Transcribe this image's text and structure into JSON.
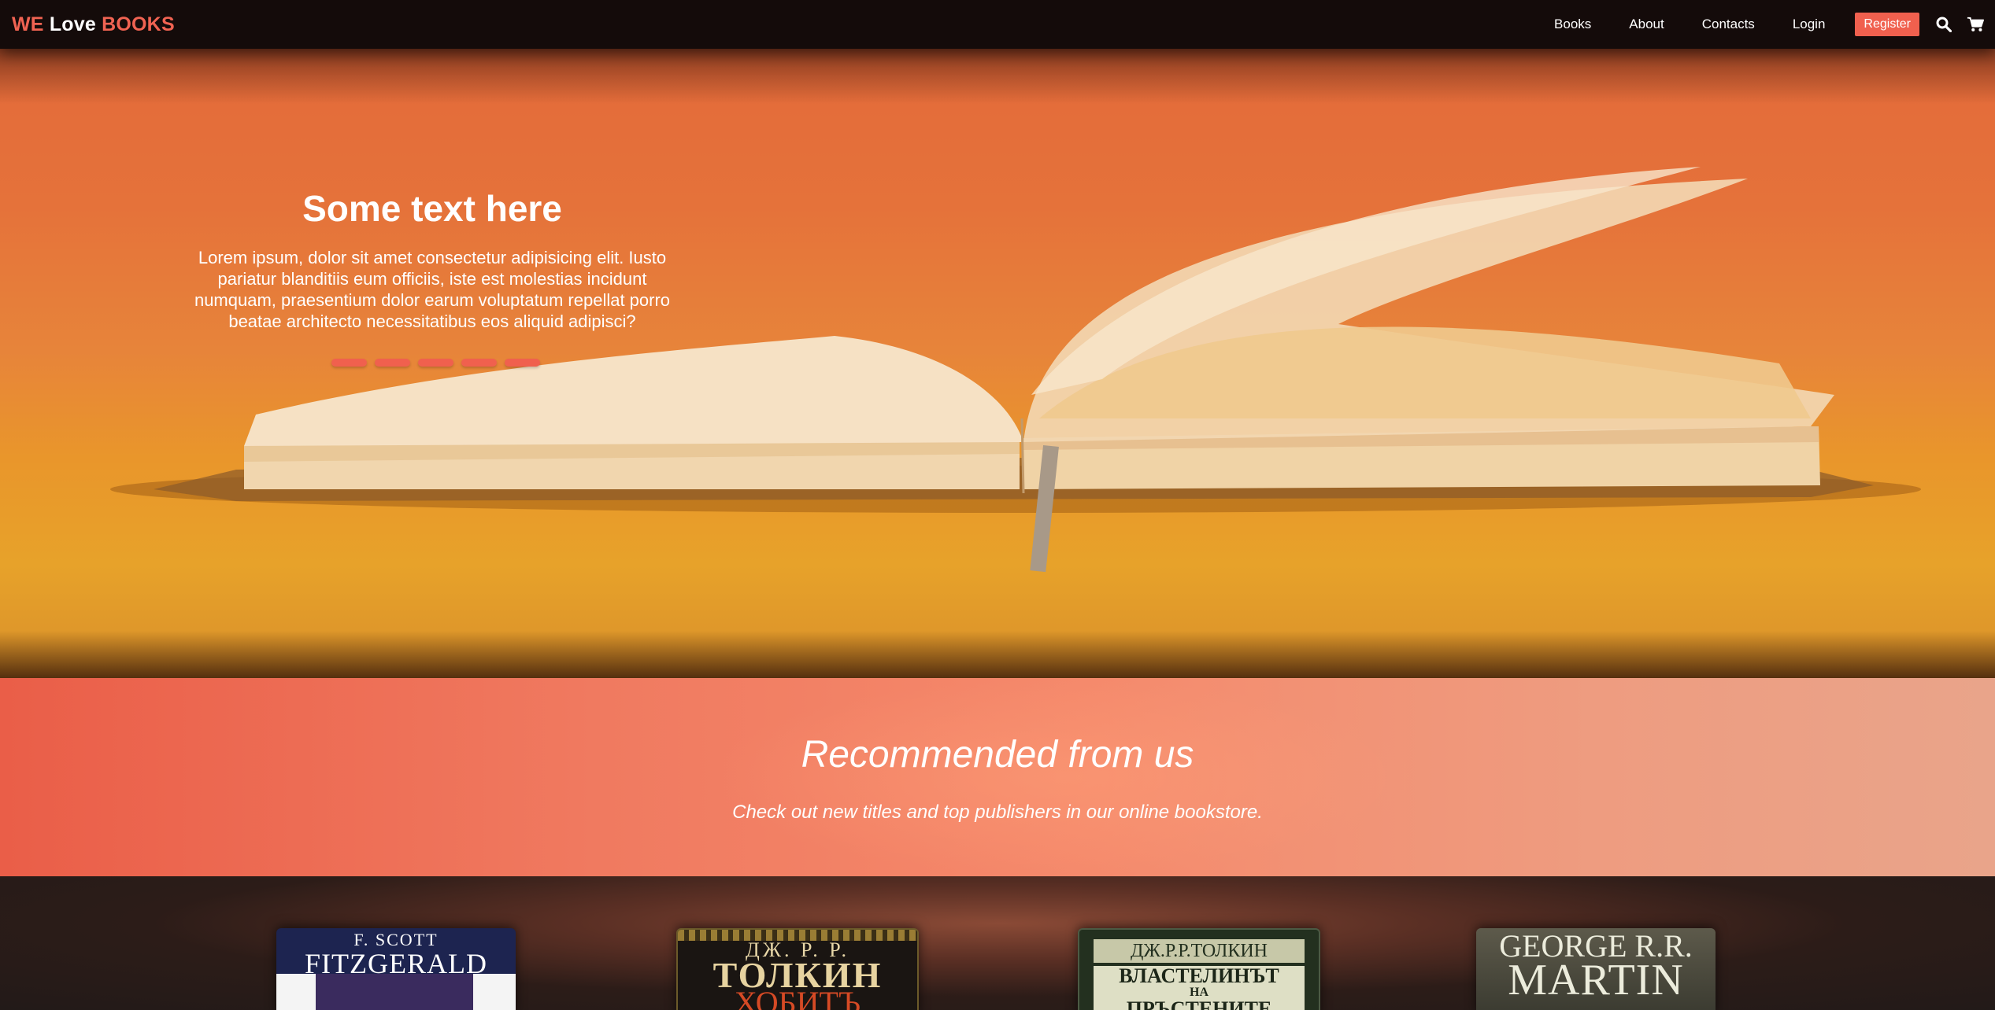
{
  "brand": {
    "part1": "WE",
    "part2": "Love",
    "part3": "BOOKS"
  },
  "nav": {
    "items": [
      "Books",
      "About",
      "Contacts",
      "Login"
    ],
    "register": "Register",
    "icons": {
      "search": "search-icon",
      "cart": "cart-icon"
    }
  },
  "hero": {
    "title": "Some text here",
    "text": "Lorem ipsum, dolor sit amet consectetur adipisicing elit. Iusto pariatur blanditiis eum officiis, iste est molestias incidunt numquam, praesentium dolor earum voluptatum repellat porro beatae architecto necessitatibus eos aliquid adipisci?",
    "indicator_count": 5
  },
  "recommended": {
    "title": "Recommended from us",
    "subtitle": "Check out new titles and top publishers in our online bookstore."
  },
  "books": [
    {
      "line1": "F. SCOTT",
      "line2": "FITZGERALD"
    },
    {
      "line1": "ДЖ. Р. Р.",
      "line2": "ТОЛКИН",
      "line3": "ХОБИТЪ"
    },
    {
      "line1": "ДЖ.Р.Р.ТОЛКИН",
      "line2": "ВЛАСТЕЛИНЪТ",
      "line3": "НА",
      "line4": "ПРЪСТЕНИТЕ"
    },
    {
      "line1": "GEORGE R.R.",
      "line2": "MARTIN"
    }
  ],
  "colors": {
    "accent": "#f0604e",
    "navbar": "#140b0a"
  }
}
